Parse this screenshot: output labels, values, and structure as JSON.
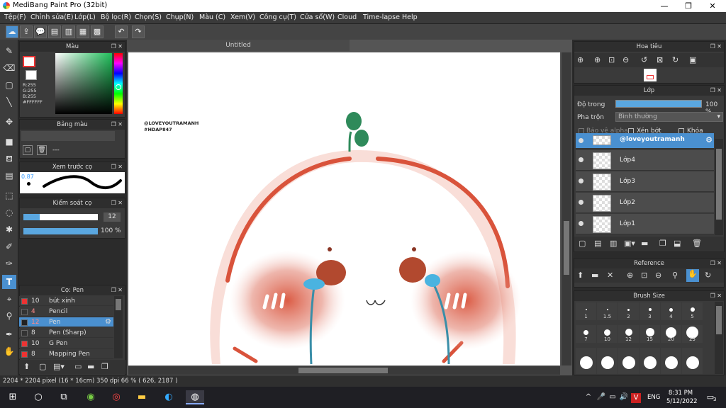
{
  "app": {
    "title": "MediBang Paint Pro (32bit)"
  },
  "menu": [
    "Tệp(F)",
    "Chỉnh sửa(E)",
    "Lớp(L)",
    "Bộ lọc(R)",
    "Chọn(S)",
    "Chụp(N)",
    "Màu (C)",
    "Xem(V)",
    "Công cụ(T)",
    "Cửa sổ(W)",
    "Cloud",
    "Time-lapse",
    "Help"
  ],
  "color_panel": {
    "title": "Màu",
    "r": "R:255",
    "g": "G:255",
    "b": "B:255",
    "hex": "#FFFFFF"
  },
  "palette_panel": {
    "title": "Bảng màu",
    "text": "---"
  },
  "preview_panel": {
    "title": "Xem trước cọ",
    "size": "0.87"
  },
  "brush_control": {
    "title": "Kiểm soát cọ",
    "size_value": "12",
    "opacity_value": "100 %"
  },
  "brush_panel": {
    "title": "Cọ: Pen",
    "items": [
      {
        "size": "10",
        "name": "bút xinh",
        "color": "#e33"
      },
      {
        "size": "4",
        "name": "Pencil",
        "color": "#333"
      },
      {
        "size": "12",
        "name": "Pen",
        "color": "#222"
      },
      {
        "size": "8",
        "name": "Pen (Sharp)",
        "color": "#333"
      },
      {
        "size": "10",
        "name": "G Pen",
        "color": "#e33"
      },
      {
        "size": "8",
        "name": "Mapping Pen",
        "color": "#e33"
      }
    ]
  },
  "document": {
    "tab": "Untitled",
    "watermark1": "@LOVEYOUTRAMANH",
    "watermark2": "#HDAP847"
  },
  "navigator": {
    "title": "Hoa tiêu"
  },
  "layer_panel": {
    "title": "Lớp",
    "opacity_label": "Độ trong",
    "opacity_value": "100 %",
    "blend_label": "Pha trộn",
    "blend_value": "Bình thường",
    "protect_alpha": "Bảo vệ alpha",
    "clip": "Xén bớt",
    "lock": "Khóa",
    "layers": [
      "@loveyoutramanh",
      "Lớp4",
      "Lớp3",
      "Lớp2",
      "Lớp1"
    ]
  },
  "reference_panel": {
    "title": "Reference"
  },
  "brush_size_panel": {
    "title": "Brush Size",
    "sizes": [
      "1",
      "1.5",
      "2",
      "3",
      "4",
      "5",
      "7",
      "10",
      "12",
      "15",
      "20",
      "25"
    ]
  },
  "status": {
    "text": "2204 * 2204 pixel  (16 * 16cm)  350 dpi  66 %  ( 626, 2187 )"
  },
  "taskbar": {
    "lang": "ENG",
    "time": "8:31 PM",
    "date": "5/12/2022",
    "notif": "3"
  },
  "colors": {
    "accent": "#4a90d0",
    "blush": "#d9533b",
    "leaf": "#2e8a5a",
    "tear": "#4ab3e0"
  }
}
